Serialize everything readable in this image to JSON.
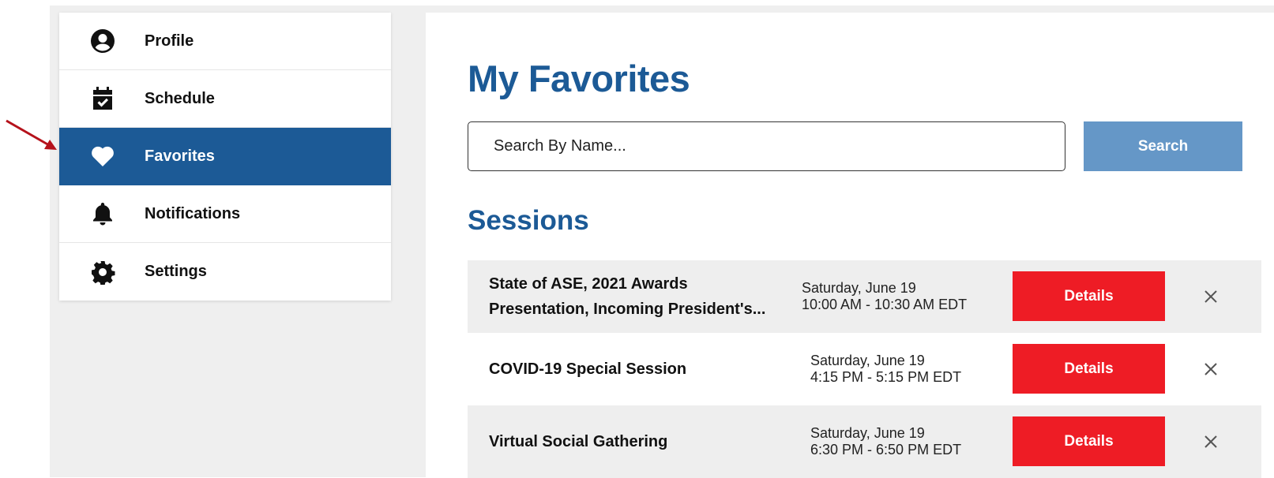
{
  "accent_color": "#1c5a96",
  "annotation_arrow_color": "#b5121b",
  "sidebar": {
    "items": [
      {
        "label": "Profile",
        "icon": "user-circle-icon",
        "active": false
      },
      {
        "label": "Schedule",
        "icon": "calendar-check-icon",
        "active": false
      },
      {
        "label": "Favorites",
        "icon": "heart-icon",
        "active": true
      },
      {
        "label": "Notifications",
        "icon": "bell-icon",
        "active": false
      },
      {
        "label": "Settings",
        "icon": "gear-icon",
        "active": false
      }
    ]
  },
  "main": {
    "title": "My Favorites",
    "search": {
      "placeholder": "Search By Name...",
      "value": "",
      "button_label": "Search"
    },
    "section_title": "Sessions",
    "sessions": [
      {
        "name": "State of ASE, 2021 Awards Presentation, Incoming President's...",
        "date": "Saturday, June 19",
        "time": "10:00 AM - 10:30 AM EDT",
        "details_label": "Details",
        "remove_icon": "close-icon"
      },
      {
        "name": "COVID-19 Special Session",
        "date": "Saturday, June 19",
        "time": "4:15 PM - 5:15 PM EDT",
        "details_label": "Details",
        "remove_icon": "close-icon"
      },
      {
        "name": "Virtual Social Gathering",
        "date": "Saturday, June 19",
        "time": "6:30 PM - 6:50 PM EDT",
        "details_label": "Details",
        "remove_icon": "close-icon"
      }
    ]
  }
}
